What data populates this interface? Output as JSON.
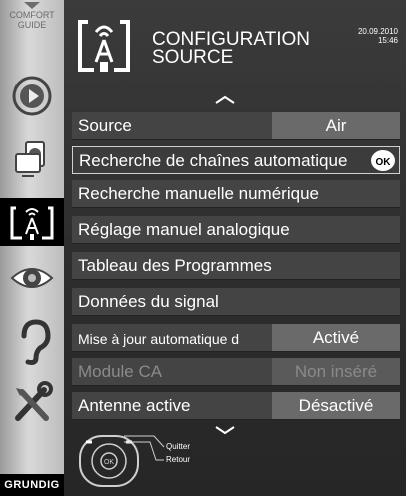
{
  "sidebar": {
    "comfort_line1": "COMFORT",
    "comfort_line2": "GUIDE",
    "icons": [
      "play-icon",
      "picture-in-picture-icon",
      "antenna-source-icon",
      "eye-icon",
      "ear-icon",
      "tools-icon"
    ],
    "active_icon": "antenna-source-icon",
    "brand": "GRUNDIG"
  },
  "header": {
    "title_line1": "CONFIGURATION",
    "title_line2": "SOURCE",
    "date": "20.09.2010",
    "time": "15:46",
    "icon": "antenna-source-icon"
  },
  "menu": [
    {
      "label": "Source",
      "value": "Air"
    },
    {
      "label": "Recherche de chaînes automatique",
      "value": "",
      "selected": true,
      "badge": "OK"
    },
    {
      "label": "Recherche manuelle numérique",
      "value": ""
    },
    {
      "label": "Réglage manuel analogique",
      "value": ""
    },
    {
      "label": "Tableau des Programmes",
      "value": ""
    },
    {
      "label": "Données du signal",
      "value": ""
    },
    {
      "label": "Mise à jour automatique d",
      "value": "Activé"
    },
    {
      "label": "Module CA",
      "value": "Non inséré",
      "disabled": true
    },
    {
      "label": "Antenne active",
      "value": "Désactivé"
    }
  ],
  "footer": {
    "remote_ok": "OK",
    "legend_quit": "Quitter",
    "legend_back": "Retour"
  },
  "colors": {
    "panel_bg": "#2e2e2e",
    "row_bg": "#444444",
    "value_bg": "#6a6a6a",
    "sidebar_bg": "#cfcfcf"
  }
}
